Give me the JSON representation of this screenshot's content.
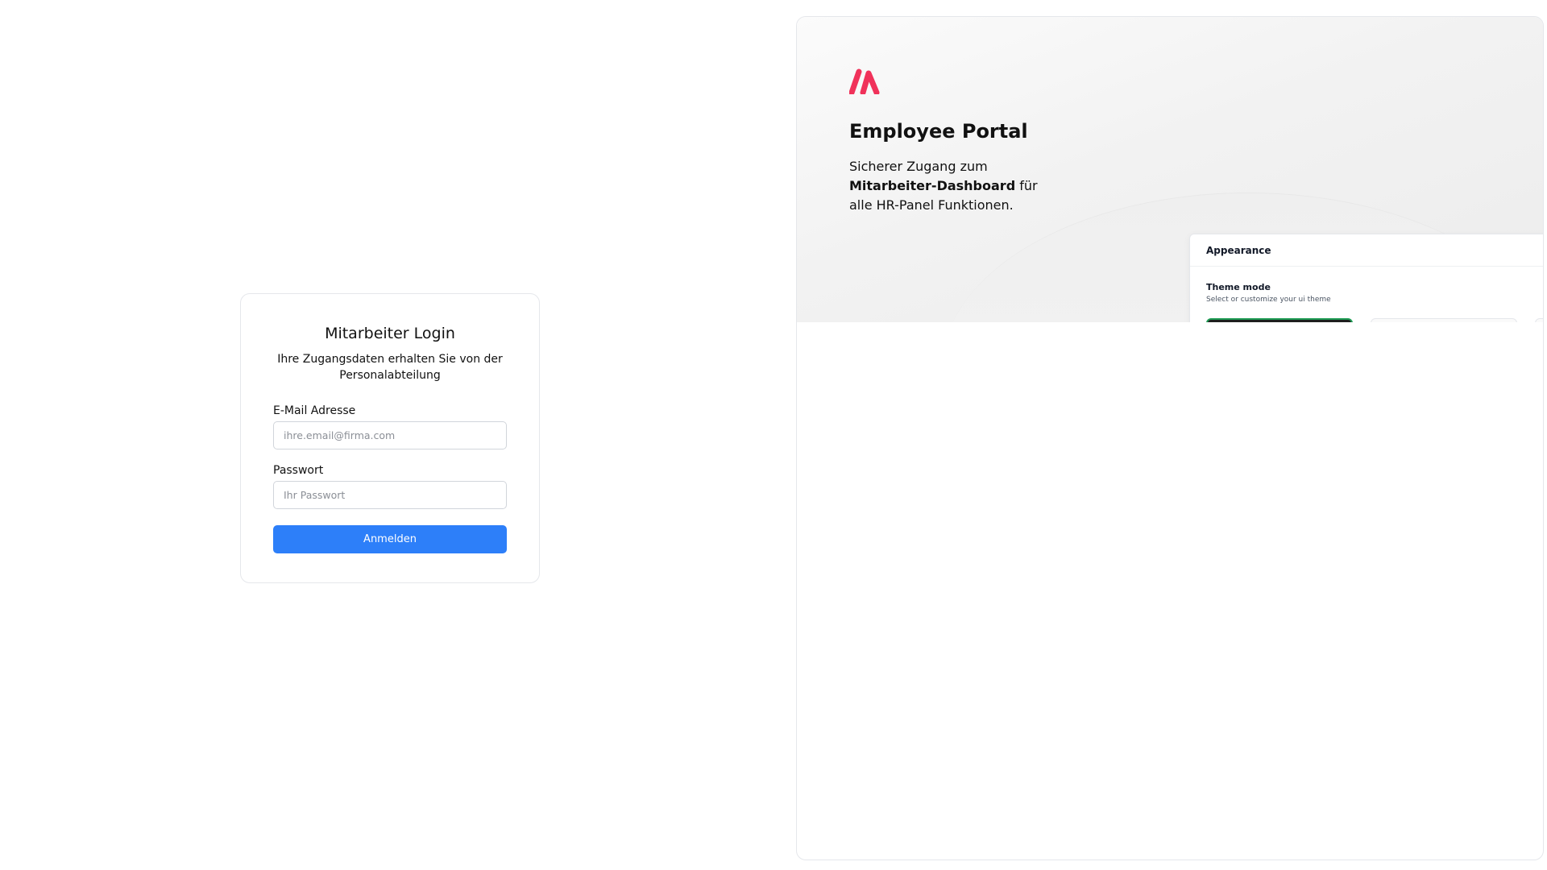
{
  "login": {
    "title": "Mitarbeiter Login",
    "subtitle": "Ihre Zugangsdaten erhalten Sie von der Personalabteilung",
    "email": {
      "label": "E-Mail Adresse",
      "placeholder": "ihre.email@firma.com",
      "value": ""
    },
    "password": {
      "label": "Passwort",
      "placeholder": "Ihr Passwort",
      "value": ""
    },
    "submit_label": "Anmelden"
  },
  "promo": {
    "logo_icon": "brand-logo-icon",
    "title": "Employee Portal",
    "desc_prefix": "Sicherer Zugang zum ",
    "desc_strong": "Mitarbeiter-Dashboard",
    "desc_suffix": " für alle HR-Panel Funktionen.",
    "preview": {
      "header": "Appearance",
      "section_title": "Theme mode",
      "section_subtitle": "Select or customize your ui theme"
    }
  },
  "colors": {
    "accent": "#2d7ff9",
    "brand": "#f0325a",
    "selected_theme_border": "#1f9d55"
  }
}
